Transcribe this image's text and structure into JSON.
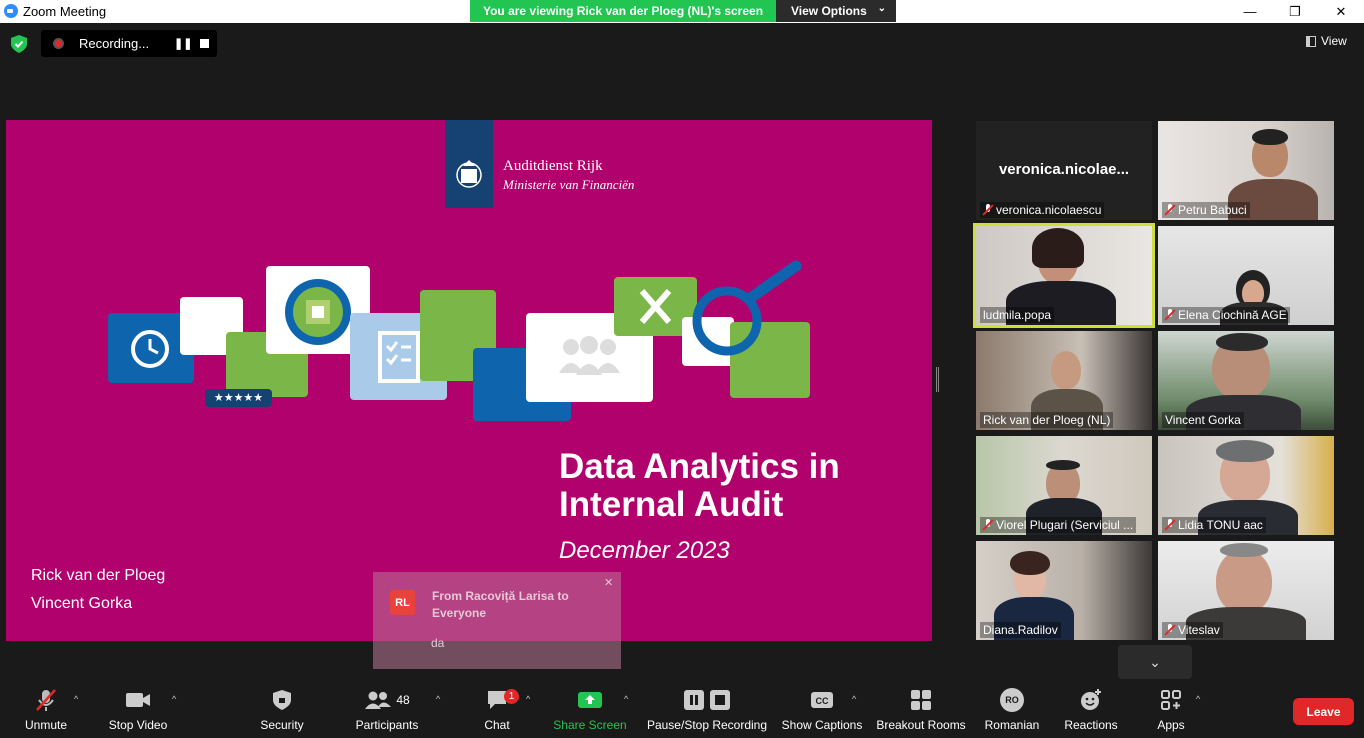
{
  "window": {
    "title": "Zoom Meeting",
    "minimize": "—",
    "maximize": "❐",
    "close": "✕"
  },
  "banner": {
    "viewing_text": "You are viewing Rick van der Ploeg (NL)'s screen",
    "view_options_label": "View Options"
  },
  "recording": {
    "label": "Recording..."
  },
  "view_button": {
    "label": "View"
  },
  "slide": {
    "org_name": "Auditdienst Rijk",
    "org_ministry": "Ministerie van Financiën",
    "title_line1": "Data Analytics in",
    "title_line2": "Internal Audit",
    "date": "December 2023",
    "presenters": [
      "Rick van der Ploeg",
      "Vincent Gorka"
    ],
    "rating_stars": "★★★★★"
  },
  "chat_toast": {
    "avatar_initials": "RL",
    "from": "From Racoviță Larisa to Everyone",
    "message": "da"
  },
  "participants": [
    {
      "name": "veronica.nicolaescu",
      "display": "veronica.nicolae...",
      "muted": true
    },
    {
      "name": "Petru Babuci",
      "muted": true
    },
    {
      "name": "ludmila.popa",
      "muted": false,
      "active_speaker": true
    },
    {
      "name": "Elena Ciochină AGE",
      "muted": true
    },
    {
      "name": "Rick van der Ploeg (NL)",
      "muted": false
    },
    {
      "name": "Vincent Gorka",
      "muted": false
    },
    {
      "name": "Viorel Plugari (Serviciul ...",
      "muted": true
    },
    {
      "name": "Lidia TONU aac",
      "muted": true
    },
    {
      "name": "Diana.Radilov",
      "muted": false
    },
    {
      "name": "Viteslav",
      "muted": true
    }
  ],
  "toolbar": {
    "unmute": "Unmute",
    "stop_video": "Stop Video",
    "security": "Security",
    "participants": "Participants",
    "participants_count": "48",
    "chat": "Chat",
    "chat_badge": "1",
    "share_screen": "Share Screen",
    "pause_stop_recording": "Pause/Stop Recording",
    "show_captions": "Show Captions",
    "breakout_rooms": "Breakout Rooms",
    "language": "Romanian",
    "language_code": "RO",
    "reactions": "Reactions",
    "apps": "Apps",
    "leave": "Leave"
  },
  "colors": {
    "share_green": "#23c552",
    "slide_magenta": "#b0016c",
    "leave_red": "#e02828",
    "active_speaker": "#cddf3b"
  }
}
